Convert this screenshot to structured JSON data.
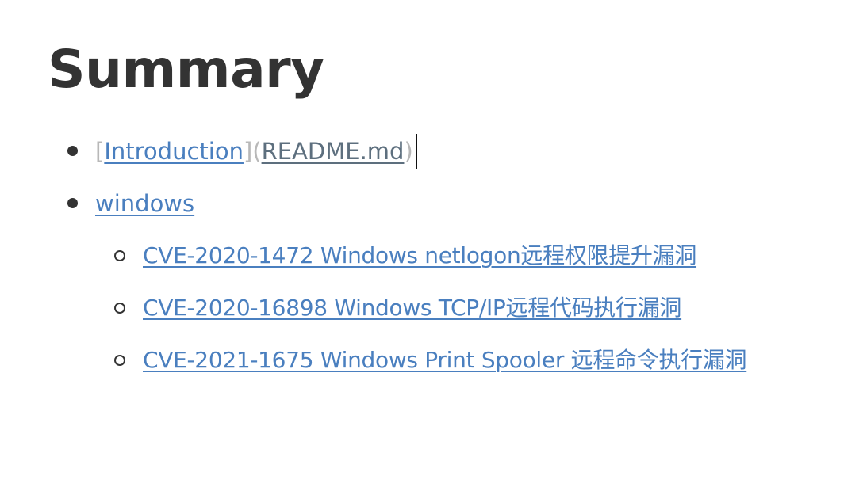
{
  "document": {
    "heading": "Summary",
    "items": [
      {
        "syntax_open_bracket": "[",
        "link_text": "Introduction",
        "syntax_mid": "](",
        "link_url": "README.md",
        "syntax_close_paren": ")"
      },
      {
        "link_text": "windows",
        "children": [
          {
            "link_text": "CVE-2020-1472 Windows netlogon远程权限提升漏洞"
          },
          {
            "link_text": "CVE-2020-16898 Windows TCP/IP远程代码执行漏洞"
          },
          {
            "link_text": "CVE-2021-1675 Windows Print Spooler 远程命令执行漏洞"
          }
        ]
      }
    ]
  },
  "colors": {
    "text": "#333333",
    "link": "#4a7fbf",
    "link_url": "#5d6f7e",
    "markdown_syntax": "#b8b8b8",
    "rule": "#e6e6e6"
  },
  "icons": {
    "level1_bullet": "disc-bullet-icon",
    "level2_bullet": "circle-bullet-icon"
  }
}
